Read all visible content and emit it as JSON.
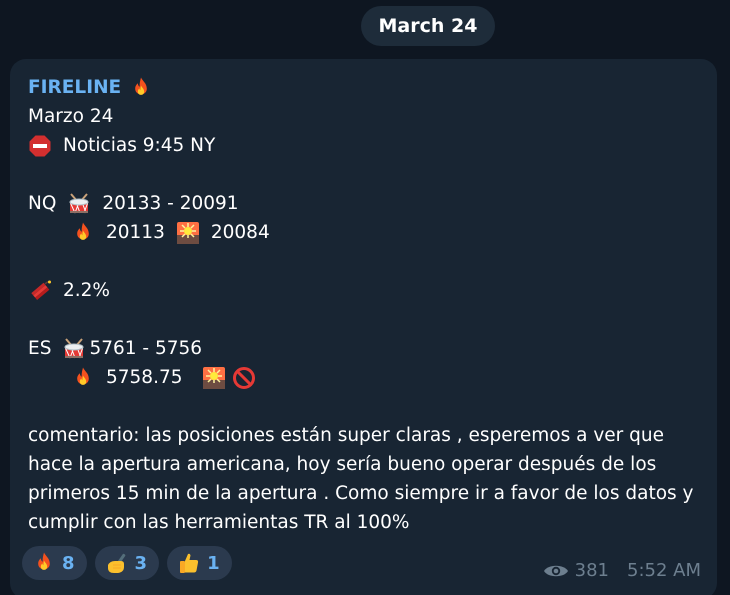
{
  "date_pill": "March 24",
  "message": {
    "author": "FIRELINE",
    "lines": {
      "date": "Marzo 24",
      "news": "Noticias 9:45 NY",
      "nq_label": "NQ",
      "nq_range": "20133 - 20091",
      "nq_fire": "20113",
      "nq_target": "20084",
      "pct": "2.2%",
      "es_label": "ES",
      "es_range": "5761 - 5756",
      "es_fire": "5758.75"
    },
    "comment": "comentario: las posiciones están super claras , esperemos a ver que hace la apertura americana, hoy sería bueno operar después de los primeros 15 min de la apertura . Como siempre ir a favor de los datos y cumplir con las herramientas TR al 100%"
  },
  "reactions": [
    {
      "icon": "fire-emoji",
      "count": "8"
    },
    {
      "icon": "writing-hand-emoji",
      "count": "3"
    },
    {
      "icon": "thumbs-up-emoji",
      "count": "1"
    }
  ],
  "meta": {
    "views": "381",
    "time": "5:52 AM"
  },
  "colors": {
    "background": "#0e1621",
    "bubble": "#182533",
    "author": "#6ab2f2",
    "meta": "#6d7f8f"
  }
}
